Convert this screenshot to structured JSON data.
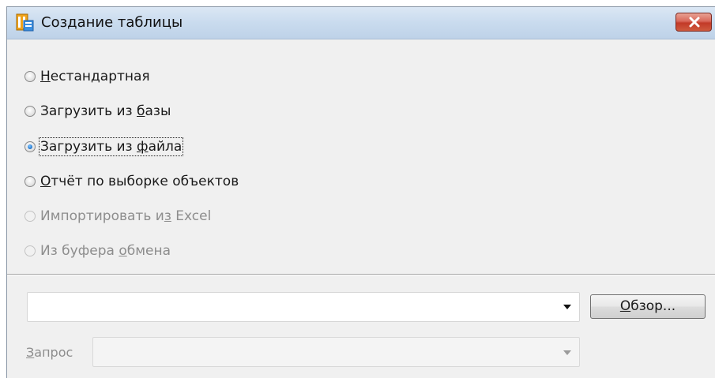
{
  "window": {
    "title": "Создание таблицы"
  },
  "options": [
    {
      "pre": "",
      "u": "Н",
      "post": "естандартная",
      "state": "unchecked"
    },
    {
      "pre": "Загрузить из ",
      "u": "б",
      "post": "азы",
      "state": "unchecked"
    },
    {
      "pre": "Загрузить из ",
      "u": "ф",
      "post": "айла",
      "state": "checked"
    },
    {
      "pre": "",
      "u": "О",
      "post": "тчёт по выборке объектов",
      "state": "unchecked"
    },
    {
      "pre": "Импортировать и",
      "u": "з",
      "post": " Excel",
      "state": "disabled"
    },
    {
      "pre": "Из буфера ",
      "u": "о",
      "post": "бмена",
      "state": "disabled"
    }
  ],
  "file_combo": {
    "value": ""
  },
  "browse_button": {
    "u": "О",
    "rest": "бзор..."
  },
  "query": {
    "u": "З",
    "rest": "апрос",
    "value": ""
  },
  "icons": {
    "app": "table-app-icon",
    "close": "close-icon",
    "dropdown": "chevron-down-icon"
  },
  "colors": {
    "close_button": "#c9442f",
    "radio_selected": "#1f73c9",
    "disabled_text": "#8d8d8d"
  }
}
